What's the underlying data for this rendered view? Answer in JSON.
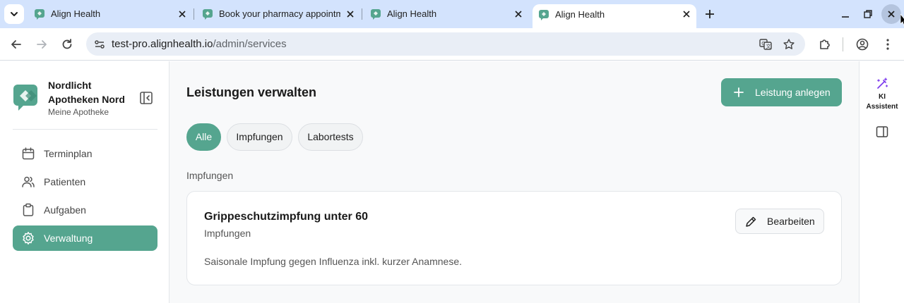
{
  "browser": {
    "tabs": [
      {
        "title": "Align Health",
        "active": false
      },
      {
        "title": "Book your pharmacy appointment",
        "active": false
      },
      {
        "title": "Align Health",
        "active": false
      },
      {
        "title": "Align Health",
        "active": true
      }
    ],
    "url_host": "test-pro.alignhealth.io",
    "url_path": "/admin/services"
  },
  "sidebar": {
    "brand_name": "Nordlicht Apotheken Nord",
    "brand_sub": "Meine Apotheke",
    "items": [
      {
        "label": "Terminplan",
        "icon": "calendar-icon",
        "active": false
      },
      {
        "label": "Patienten",
        "icon": "users-icon",
        "active": false
      },
      {
        "label": "Aufgaben",
        "icon": "clipboard-icon",
        "active": false
      },
      {
        "label": "Verwaltung",
        "icon": "gear-icon",
        "active": true
      }
    ]
  },
  "main": {
    "title": "Leistungen verwalten",
    "add_button": "Leistung anlegen",
    "filters": [
      {
        "label": "Alle",
        "active": true
      },
      {
        "label": "Impfungen",
        "active": false
      },
      {
        "label": "Labortests",
        "active": false
      }
    ],
    "section": "Impfungen",
    "services": [
      {
        "name": "Grippeschutzimpfung unter 60",
        "category": "Impfungen",
        "description": "Saisonale Impfung gegen Influenza inkl. kurzer Anamnese.",
        "edit_label": "Bearbeiten"
      }
    ]
  },
  "assistant": {
    "label_line1": "KI",
    "label_line2": "Assistent"
  },
  "colors": {
    "accent": "#55a58f",
    "tabstrip": "#d3e3fd",
    "omnibox": "#e9eef6"
  }
}
